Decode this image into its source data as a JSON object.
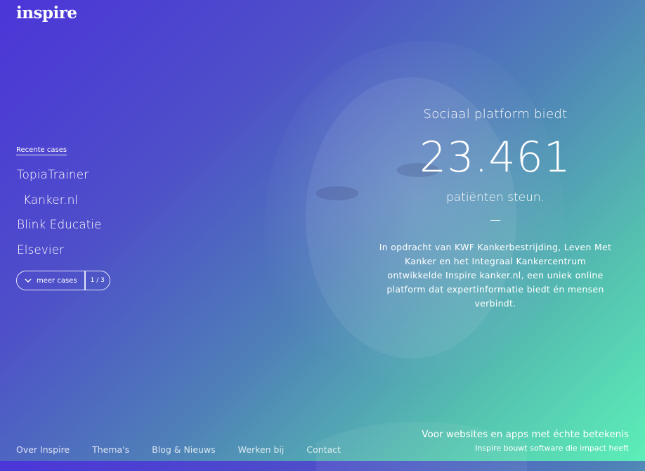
{
  "logo": "inspire",
  "sidebar": {
    "recent_label": "Recente cases",
    "cases": [
      "TopiaTrainer",
      "Kanker.nl",
      "Blink Educatie",
      "Elsevier"
    ],
    "more_label": "meer cases",
    "page_indicator": "1 / 3"
  },
  "hero": {
    "lead": "Sociaal platform biedt",
    "number": "23.461",
    "sub": "patiënten steun.",
    "description": "In opdracht van KWF Kankerbestrijding, Leven Met Kanker en het Integraal Kankercentrum ontwikkelde Inspire kanker.nl, een uniek online platform dat expertinformatie biedt én mensen verbindt."
  },
  "footer": {
    "nav": [
      "Over Inspire",
      "Thema's",
      "Blog & Nieuws",
      "Werken bij",
      "Contact"
    ],
    "tagline_title": "Voor websites en apps met échte betekenis",
    "tagline_sub": "Inspire bouwt software die impact heeft"
  },
  "colors": {
    "gradient_start": "#4b35d8",
    "gradient_end": "#5cefb8"
  }
}
